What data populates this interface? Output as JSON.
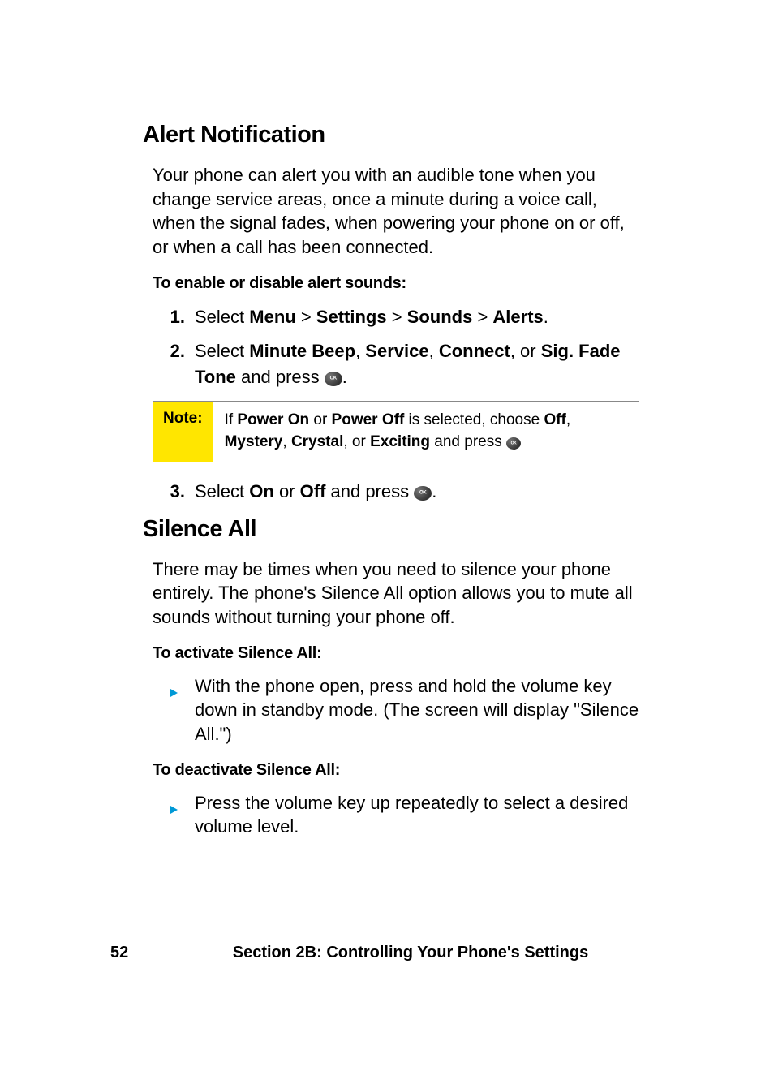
{
  "section1": {
    "heading": "Alert Notification",
    "intro": "Your phone can alert you with an audible tone when you change service areas, once a minute during a voice call, when the signal fades, when powering your phone on or off, or when a call has been connected.",
    "task_label": "To enable or disable alert sounds:",
    "steps": {
      "s1": {
        "num": "1.",
        "pre": "Select ",
        "b1": "Menu",
        "g1": " > ",
        "b2": "Settings",
        "g2": " > ",
        "b3": "Sounds",
        "g3": " > ",
        "b4": "Alerts",
        "post": "."
      },
      "s2": {
        "num": "2.",
        "pre": "Select ",
        "b1": "Minute Beep",
        "c1": ", ",
        "b2": "Service",
        "c2": ", ",
        "b3": "Connect",
        "c3": ", or ",
        "b4": "Sig. Fade Tone",
        "post1": " and press ",
        "post2": "."
      },
      "s3": {
        "num": "3.",
        "pre": "Select ",
        "b1": "On",
        "mid": " or ",
        "b2": "Off",
        "post1": " and press ",
        "post2": "."
      }
    },
    "note": {
      "label": "Note:",
      "t1": "If ",
      "b1": "Power On",
      "t2": " or ",
      "b2": "Power Off",
      "t3": " is selected, choose ",
      "b3": "Off",
      "t4": ", ",
      "b4": "Mystery",
      "t5": ", ",
      "b5": "Crystal",
      "t6": ", or ",
      "b6": "Exciting",
      "t7": " and press "
    }
  },
  "section2": {
    "heading": "Silence All",
    "intro": "There may be times when you need to silence your phone entirely. The phone's Silence All option allows you to mute all sounds without turning your phone off.",
    "task1_label": "To activate Silence All:",
    "bullet1": "With the phone open, press and hold the volume key down in standby mode. (The screen will display \"Silence All.\")",
    "task2_label": "To deactivate Silence All:",
    "bullet2": "Press the volume key up repeatedly to select a desired volume level."
  },
  "footer": {
    "page": "52",
    "text": "Section 2B: Controlling Your Phone's Settings"
  }
}
